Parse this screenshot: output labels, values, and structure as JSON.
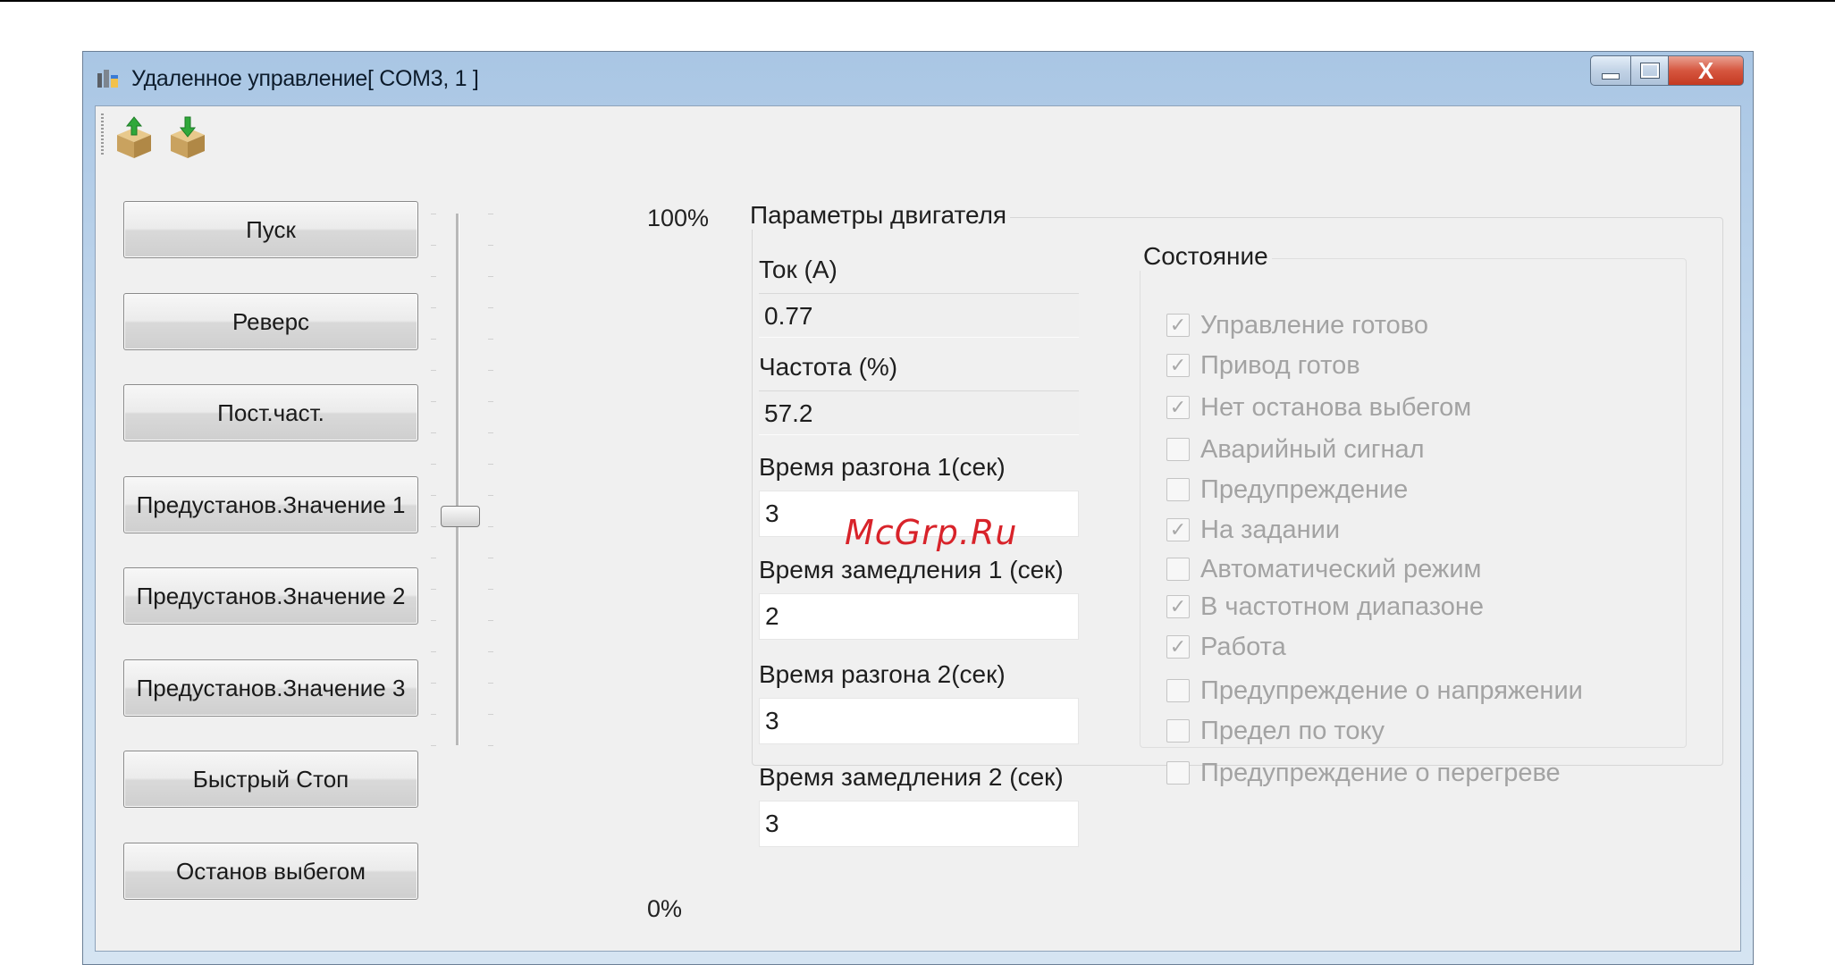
{
  "window": {
    "title": "Удаленное управление[ COM3, 1 ]",
    "close_glyph": "X"
  },
  "toolbar": {
    "icons": [
      "box-download-icon",
      "box-upload-icon"
    ]
  },
  "commands": [
    {
      "label": "Пуск"
    },
    {
      "label": "Реверс"
    },
    {
      "label": "Пост.част."
    },
    {
      "label": "Предустанов.Значение 1"
    },
    {
      "label": "Предустанов.Значение 2"
    },
    {
      "label": "Предустанов.Значение 3"
    },
    {
      "label": "Быстрый Стоп"
    },
    {
      "label": "Останов выбегом"
    }
  ],
  "slider": {
    "max_label": "100%",
    "min_label": "0%",
    "level": 0.43
  },
  "params": {
    "title": "Параметры двигателя",
    "current_label": "Ток (А)",
    "current_value": "0.77",
    "freq_label": "Частота (%)",
    "freq_value": "57.2",
    "accel1_label": "Время разгона 1(сек)",
    "accel1_value": "3",
    "decel1_label": "Время замедления 1 (сек)",
    "decel1_value": "2",
    "accel2_label": "Время разгона 2(сек)",
    "accel2_value": "3",
    "decel2_label": "Время замедления 2 (сек)",
    "decel2_value": "3"
  },
  "state": {
    "title": "Состояние",
    "items": [
      {
        "label": "Управление готово",
        "checked": true
      },
      {
        "label": "Привод готов",
        "checked": true
      },
      {
        "label": "Нет останова выбегом",
        "checked": true
      },
      {
        "label": "Аварийный сигнал",
        "checked": false
      },
      {
        "label": "Предупреждение",
        "checked": false
      },
      {
        "label": "На задании",
        "checked": true
      },
      {
        "label": "Автоматический режим",
        "checked": false
      },
      {
        "label": "В частотном диапазоне",
        "checked": true
      },
      {
        "label": "Работа",
        "checked": true
      },
      {
        "label": "Предупреждение о напряжении",
        "checked": false
      },
      {
        "label": "Предел по току",
        "checked": false
      },
      {
        "label": "Предупреждение о перегреве",
        "checked": false
      }
    ]
  },
  "watermark": "McGrp.Ru",
  "colors": {
    "window_frame": "#a9c6e4",
    "close_button": "#d6563f",
    "watermark": "#d8232a",
    "disabled_text": "#a3a3a3"
  }
}
